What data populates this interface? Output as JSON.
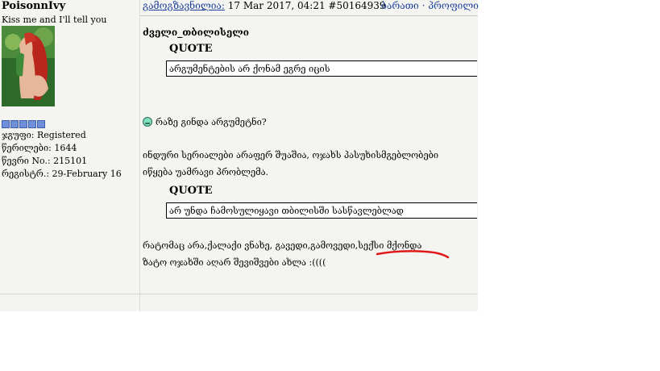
{
  "user": {
    "name": "PoisonnIvy",
    "tagline": "Kiss me and I'll tell you",
    "group": "ჯგუფი: Registered",
    "posts": "წერილები: 1644",
    "member_no": "წევრი No.: 215101",
    "registered": "რეგისტრ.: 29-February 16"
  },
  "post": {
    "posted_label": "გამოგზავნილია:",
    "posted_date": " 17 Mar 2017, 04:21 ",
    "post_id": "#50164939",
    "nav": "ბარათი · პროფილი",
    "quote_author": "ძველი_თბილისელი",
    "quote_label_1": "QUOTE",
    "quote_text_1": "არგუმენტების არ ქონამ ეგრე იცის",
    "reply_1": "რაზე გინდა არგუმეტნი?",
    "paragraph_1_line_1": "ინდური სერიალები არაფერ შუაშია, ოჯახს პასუხისმგებლობები",
    "paragraph_1_line_2": "იწყება უამრავი პრობლემა.",
    "quote_label_2": "QUOTE",
    "quote_text_2": "არ უნდა ჩამოსულიყავი თბილისში სასწავლებლად",
    "paragraph_2_line_1": "რატომაც არა,ქალაქი ვნახე, გავედი,გამოვედი,სექსი მქონდა",
    "paragraph_2_line_2": "ზატო ოჯახში აღარ შევიშვები ახლა :(((("
  },
  "colors": {
    "link": "#1c3f9c",
    "post_bg": "#f4f5f1",
    "underline_mark": "#e01818",
    "rank_dot": "#6f8fd8"
  },
  "icons": {
    "smiley": "smiley-icon",
    "rank": "rank-pips-icon"
  }
}
